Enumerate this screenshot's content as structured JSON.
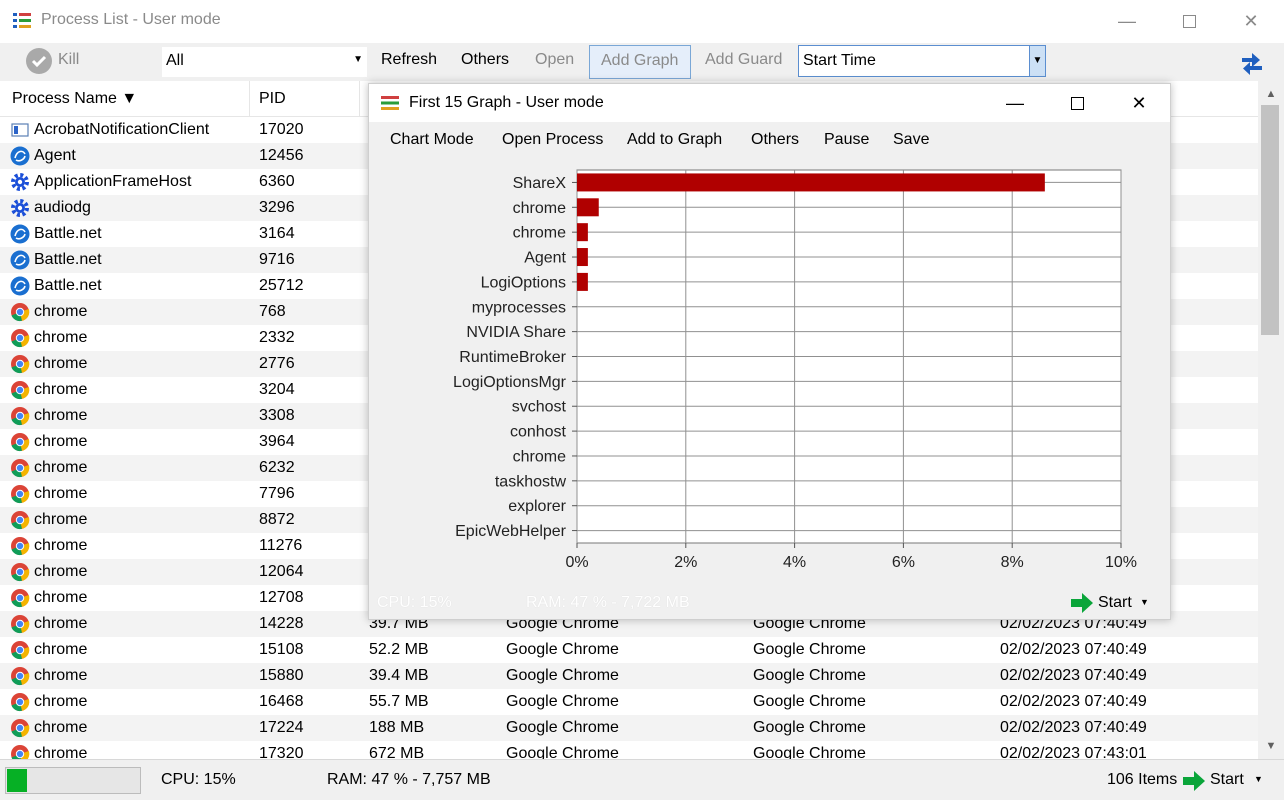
{
  "window": {
    "title": "Process List - User mode"
  },
  "toolbar": {
    "kill": "Kill",
    "filter_value": "All",
    "refresh": "Refresh",
    "others": "Others",
    "open": "Open",
    "add_graph": "Add Graph",
    "add_guard": "Add Guard",
    "column_select": "Start Time"
  },
  "columns": {
    "name": "Process Name ▼",
    "pid": "PID"
  },
  "rows": [
    {
      "icon": "acrobat-icon",
      "name": "AcrobatNotificationClient",
      "pid": "17020"
    },
    {
      "icon": "agent-icon",
      "name": "Agent",
      "pid": "12456"
    },
    {
      "icon": "gear-icon",
      "name": "ApplicationFrameHost",
      "pid": "6360"
    },
    {
      "icon": "gear-icon",
      "name": "audiodg",
      "pid": "3296"
    },
    {
      "icon": "battlenet-icon",
      "name": "Battle.net",
      "pid": "3164"
    },
    {
      "icon": "battlenet-icon",
      "name": "Battle.net",
      "pid": "9716"
    },
    {
      "icon": "battlenet-icon",
      "name": "Battle.net",
      "pid": "25712"
    },
    {
      "icon": "chrome-icon",
      "name": "chrome",
      "pid": "768"
    },
    {
      "icon": "chrome-icon",
      "name": "chrome",
      "pid": "2332"
    },
    {
      "icon": "chrome-icon",
      "name": "chrome",
      "pid": "2776"
    },
    {
      "icon": "chrome-icon",
      "name": "chrome",
      "pid": "3204"
    },
    {
      "icon": "chrome-icon",
      "name": "chrome",
      "pid": "3308"
    },
    {
      "icon": "chrome-icon",
      "name": "chrome",
      "pid": "3964"
    },
    {
      "icon": "chrome-icon",
      "name": "chrome",
      "pid": "6232"
    },
    {
      "icon": "chrome-icon",
      "name": "chrome",
      "pid": "7796"
    },
    {
      "icon": "chrome-icon",
      "name": "chrome",
      "pid": "8872"
    },
    {
      "icon": "chrome-icon",
      "name": "chrome",
      "pid": "11276"
    },
    {
      "icon": "chrome-icon",
      "name": "chrome",
      "pid": "12064"
    },
    {
      "icon": "chrome-icon",
      "name": "chrome",
      "pid": "12708"
    },
    {
      "icon": "chrome-icon",
      "name": "chrome",
      "pid": "14228",
      "mem": "39.7 MB",
      "desc": "Google Chrome",
      "company": "Google Chrome",
      "start": "02/02/2023 07:40:49"
    },
    {
      "icon": "chrome-icon",
      "name": "chrome",
      "pid": "15108",
      "mem": "52.2 MB",
      "desc": "Google Chrome",
      "company": "Google Chrome",
      "start": "02/02/2023 07:40:49"
    },
    {
      "icon": "chrome-icon",
      "name": "chrome",
      "pid": "15880",
      "mem": "39.4 MB",
      "desc": "Google Chrome",
      "company": "Google Chrome",
      "start": "02/02/2023 07:40:49"
    },
    {
      "icon": "chrome-icon",
      "name": "chrome",
      "pid": "16468",
      "mem": "55.7 MB",
      "desc": "Google Chrome",
      "company": "Google Chrome",
      "start": "02/02/2023 07:40:49"
    },
    {
      "icon": "chrome-icon",
      "name": "chrome",
      "pid": "17224",
      "mem": "188 MB",
      "desc": "Google Chrome",
      "company": "Google Chrome",
      "start": "02/02/2023 07:40:49"
    },
    {
      "icon": "chrome-icon",
      "name": "chrome",
      "pid": "17320",
      "mem": "672 MB",
      "desc": "Google Chrome",
      "company": "Google Chrome",
      "start": "02/02/2023 07:43:01"
    }
  ],
  "status": {
    "cpu_fraction": 0.15,
    "cpu": "CPU: 15%",
    "ram": "RAM: 47 % - 7,757 MB",
    "items": "106 Items",
    "start": "Start"
  },
  "graph_window": {
    "title": "First 15 Graph - User mode",
    "menu": [
      "Chart Mode",
      "Open Process",
      "Add to Graph",
      "Others",
      "Pause",
      "Save"
    ],
    "status_cpu": "CPU: 15%",
    "status_ram": "RAM: 47 % - 7,722 MB",
    "start": "Start"
  },
  "chart_data": {
    "type": "bar",
    "orientation": "horizontal",
    "categories": [
      "ShareX",
      "chrome",
      "chrome",
      "Agent",
      "LogiOptions",
      "myprocesses",
      "NVIDIA Share",
      "RuntimeBroker",
      "LogiOptionsMgr",
      "svchost",
      "conhost",
      "chrome",
      "taskhostw",
      "explorer",
      "EpicWebHelper"
    ],
    "values": [
      8.6,
      0.4,
      0.2,
      0.2,
      0.2,
      0,
      0,
      0,
      0,
      0,
      0,
      0,
      0,
      0,
      0
    ],
    "xlim": [
      0,
      10
    ],
    "xticks": [
      "0%",
      "2%",
      "4%",
      "6%",
      "8%",
      "10%"
    ],
    "grid": true,
    "bar_color": "#b00000"
  }
}
